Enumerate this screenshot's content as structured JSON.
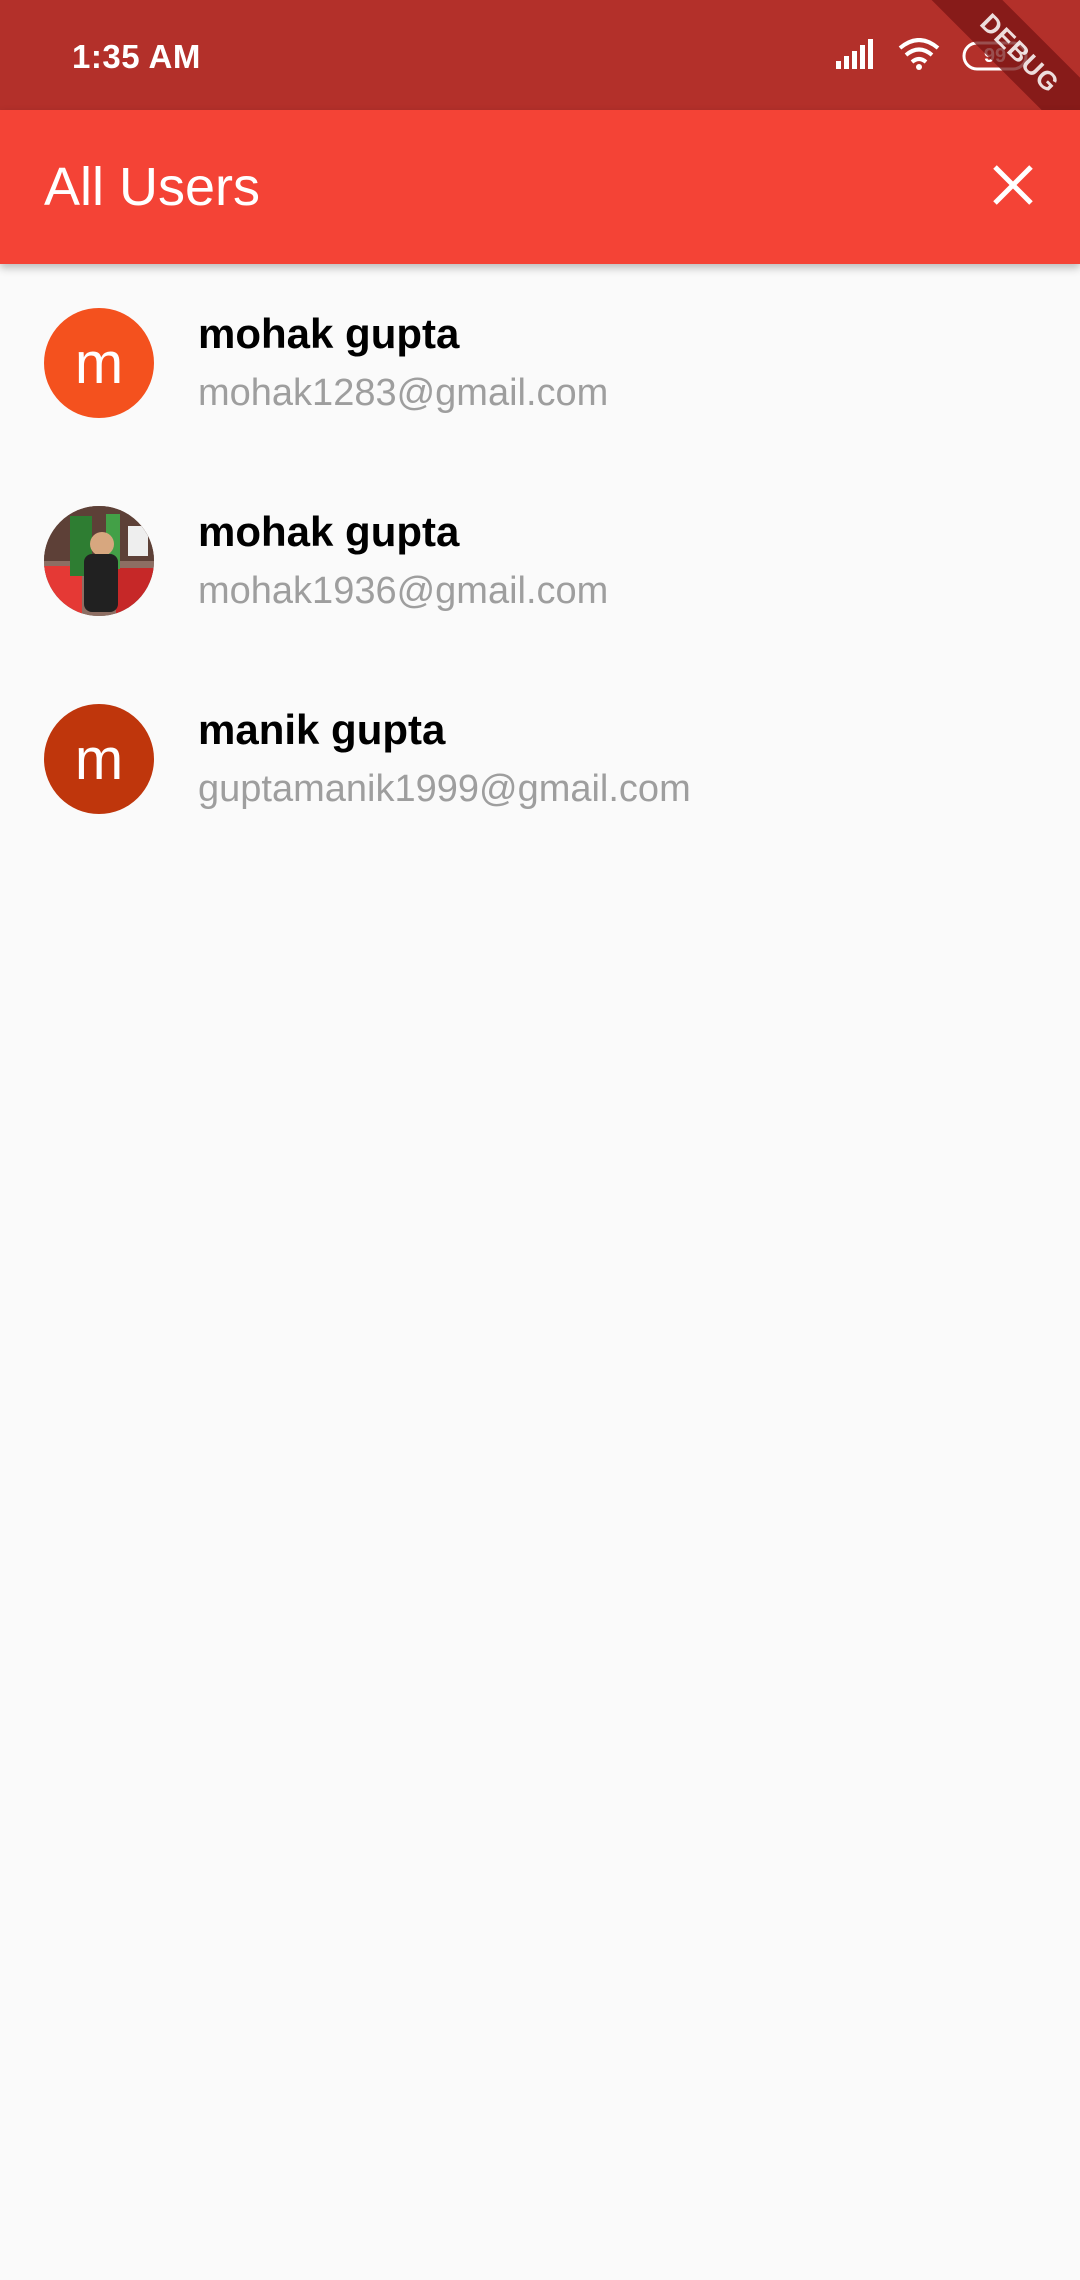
{
  "status_bar": {
    "time": "1:35 AM",
    "battery_level": "99",
    "debug_label": "DEBUG"
  },
  "app_bar": {
    "title": "All Users",
    "close_icon": "close-icon",
    "background_color": "#f44336"
  },
  "users": [
    {
      "initial": "m",
      "name": "mohak gupta",
      "email": "mohak1283@gmail.com",
      "avatar_type": "letter",
      "avatar_color": "#f4511e"
    },
    {
      "initial": "",
      "name": "mohak gupta",
      "email": "mohak1936@gmail.com",
      "avatar_type": "photo",
      "avatar_color": ""
    },
    {
      "initial": "m",
      "name": "manik gupta",
      "email": "guptamanik1999@gmail.com",
      "avatar_type": "letter",
      "avatar_color": "#bf360c"
    }
  ]
}
